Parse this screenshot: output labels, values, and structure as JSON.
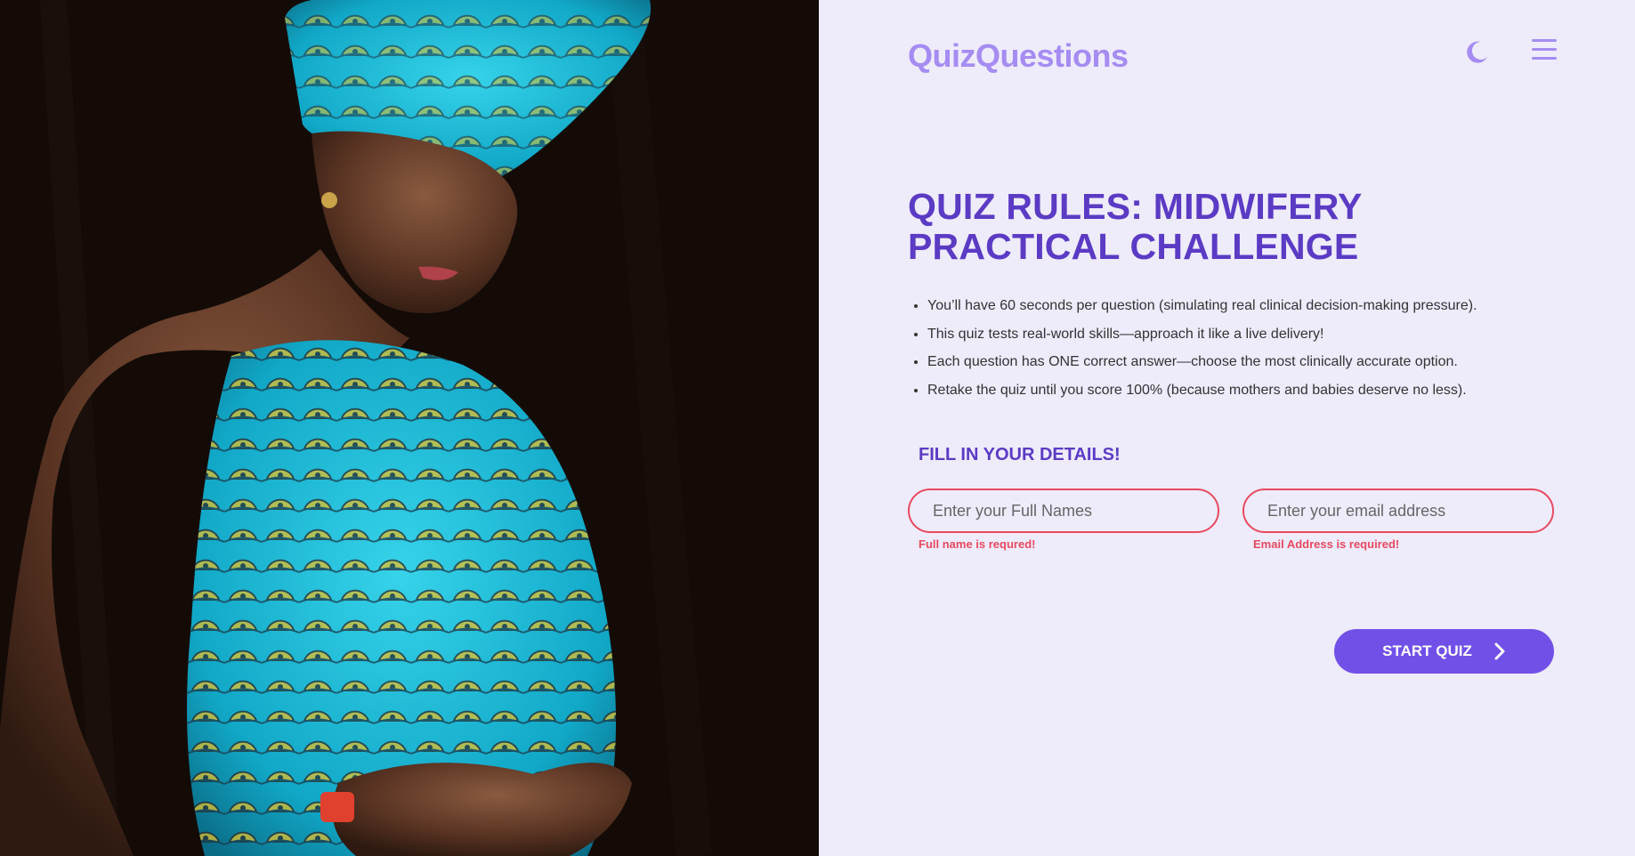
{
  "header": {
    "brand": "QuizQuestions",
    "theme_toggle_icon": "moon-icon",
    "menu_icon": "hamburger-icon"
  },
  "main": {
    "title": "QUIZ RULES: MIDWIFERY PRACTICAL CHALLENGE",
    "rules": [
      "You’ll have 60 seconds per question (simulating real clinical decision-making pressure).",
      "This quiz tests real-world skills—approach it like a live delivery!",
      "Each question has ONE correct answer—choose the most clinically accurate option.",
      "Retake the quiz until you score 100% (because mothers and babies deserve no less)."
    ],
    "details_heading": "FILL IN YOUR DETAILS!",
    "form": {
      "full_name": {
        "placeholder": "Enter your Full Names",
        "value": "",
        "error": "Full name is requred!"
      },
      "email": {
        "placeholder": "Enter your email address",
        "value": "",
        "error": "Email Address is required!"
      }
    },
    "start_button": {
      "label": "START QUIZ",
      "icon": "chevron-right-icon"
    }
  },
  "hero_image": {
    "subject": "pregnant-woman-photo"
  },
  "colors": {
    "brand": "#a58cf2",
    "heading": "#5b3bc4",
    "panel_background": "#eeebfb",
    "error": "#e84a5f",
    "button": "#7150e8"
  }
}
